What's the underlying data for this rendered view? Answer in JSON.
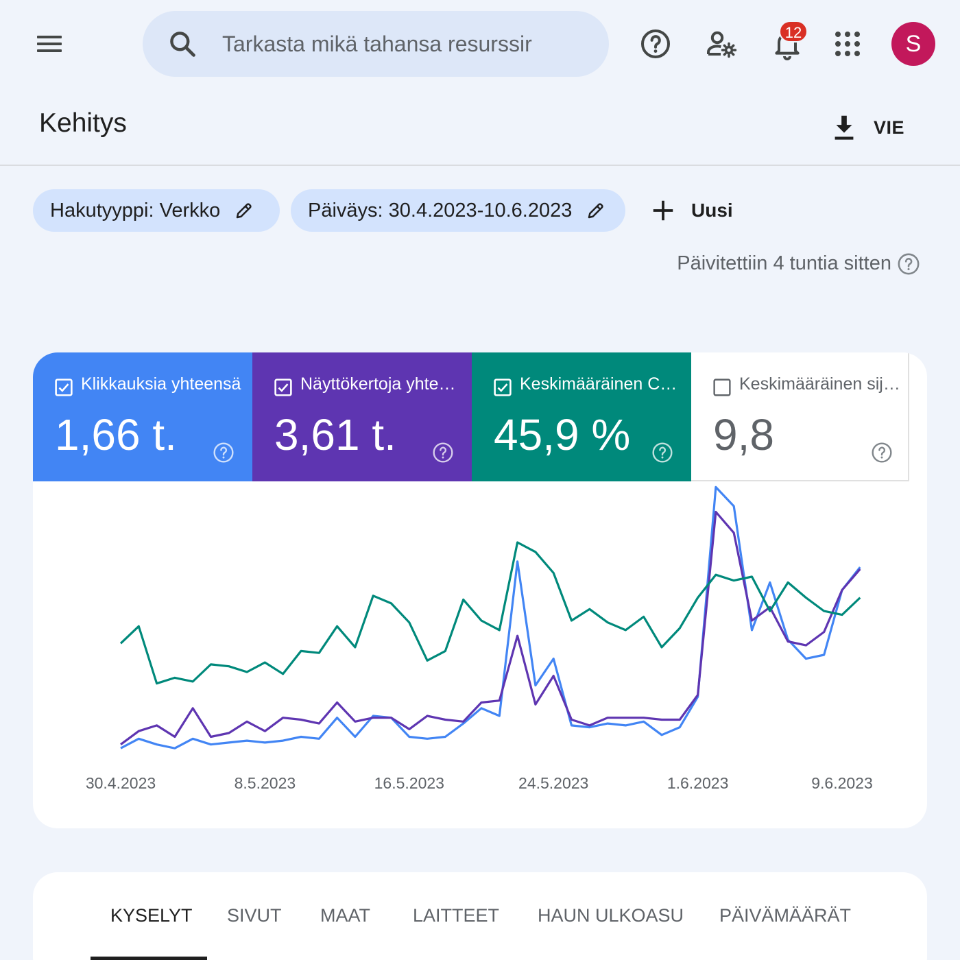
{
  "search": {
    "placeholder": "Tarkasta mikä tahansa resurssir"
  },
  "notifications": {
    "count": "12"
  },
  "user": {
    "initial": "S",
    "avatar_color": "#c2185b"
  },
  "page": {
    "title": "Kehitys",
    "export_label": "VIE"
  },
  "filters": {
    "chips": [
      {
        "label": "Hakutyyppi: Verkko"
      },
      {
        "label": "Päiväys: 30.4.2023-10.6.2023"
      }
    ],
    "new_label": "Uusi",
    "updated_text": "Päivitettiin 4 tuntia sitten"
  },
  "metrics": [
    {
      "label": "Klikkauksia yhteensä",
      "value": "1,66 t.",
      "checked": true,
      "color": "#4285f4"
    },
    {
      "label": "Näyttökertoja yhteensä",
      "value": "3,61 t.",
      "checked": true,
      "color": "#5e35b1"
    },
    {
      "label": "Keskimääräinen CTR",
      "value": "45,9 %",
      "checked": true,
      "color": "#00897b"
    },
    {
      "label": "Keskimääräinen sijainti",
      "value": "9,8",
      "checked": false,
      "color": "#ffffff"
    }
  ],
  "chart_data": {
    "type": "line",
    "x": [
      "30.4.2023",
      "1.5.2023",
      "2.5.2023",
      "3.5.2023",
      "4.5.2023",
      "5.5.2023",
      "6.5.2023",
      "7.5.2023",
      "8.5.2023",
      "9.5.2023",
      "10.5.2023",
      "11.5.2023",
      "12.5.2023",
      "13.5.2023",
      "14.5.2023",
      "15.5.2023",
      "16.5.2023",
      "17.5.2023",
      "18.5.2023",
      "19.5.2023",
      "20.5.2023",
      "21.5.2023",
      "22.5.2023",
      "23.5.2023",
      "24.5.2023",
      "25.5.2023",
      "26.5.2023",
      "27.5.2023",
      "28.5.2023",
      "29.5.2023",
      "30.5.2023",
      "31.5.2023",
      "1.6.2023",
      "2.6.2023",
      "3.6.2023",
      "4.6.2023",
      "5.6.2023",
      "6.6.2023",
      "7.6.2023",
      "8.6.2023",
      "9.6.2023",
      "10.6.2023"
    ],
    "xticks": [
      "30.4.2023",
      "8.5.2023",
      "16.5.2023",
      "24.5.2023",
      "1.6.2023",
      "9.6.2023"
    ],
    "series": [
      {
        "name": "Klikkauksia yhteensä",
        "color": "#4285f4",
        "values": [
          1,
          6,
          3,
          1,
          6,
          3,
          4,
          5,
          4,
          5,
          7,
          6,
          17,
          7,
          18,
          17,
          7,
          6,
          7,
          14,
          22,
          18,
          99,
          34,
          48,
          13,
          12,
          14,
          13,
          15,
          8,
          12,
          28,
          138,
          128,
          63,
          88,
          58,
          48,
          50,
          84,
          96
        ]
      },
      {
        "name": "Näyttökertoja yhteensä",
        "color": "#5e35b1",
        "values": [
          3,
          10,
          13,
          7,
          22,
          7,
          9,
          15,
          10,
          17,
          16,
          14,
          25,
          15,
          17,
          17,
          11,
          18,
          16,
          15,
          25,
          26,
          60,
          24,
          39,
          16,
          13,
          17,
          17,
          17,
          16,
          16,
          29,
          125,
          114,
          68,
          75,
          57,
          55,
          62,
          84,
          95
        ]
      },
      {
        "name": "Keskimääräinen CTR",
        "color": "#00897b",
        "values": [
          56,
          65,
          35,
          38,
          36,
          45,
          44,
          41,
          46,
          40,
          52,
          51,
          65,
          54,
          81,
          77,
          67,
          47,
          52,
          79,
          68,
          63,
          109,
          104,
          93,
          68,
          74,
          67,
          63,
          70,
          54,
          64,
          80,
          92,
          89,
          91,
          73,
          88,
          80,
          73,
          71,
          80
        ]
      }
    ]
  },
  "tabs": [
    {
      "label": "KYSELYT"
    },
    {
      "label": "SIVUT"
    },
    {
      "label": "MAAT"
    },
    {
      "label": "LAITTEET"
    },
    {
      "label": "HAUN ULKOASU"
    },
    {
      "label": "PÄIVÄMÄÄRÄT"
    }
  ]
}
